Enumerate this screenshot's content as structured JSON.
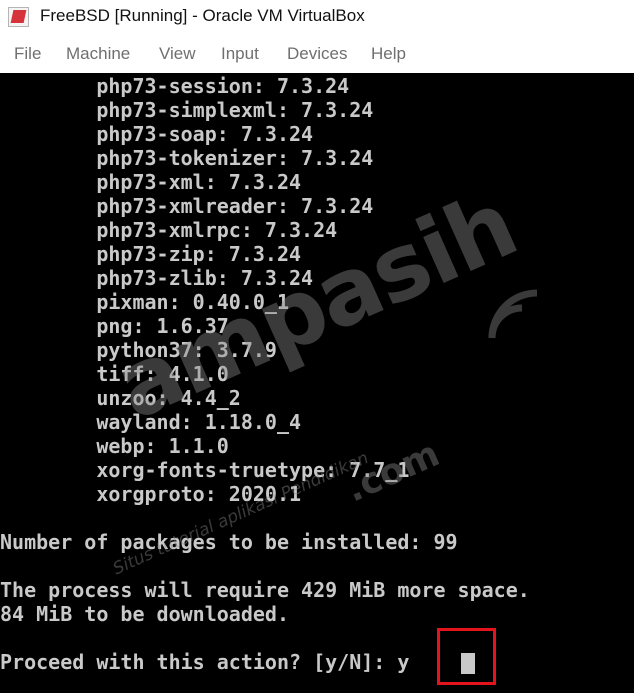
{
  "window": {
    "title": "FreeBSD [Running] - Oracle VM VirtualBox",
    "icon": "virtualbox-logo-icon"
  },
  "menu": [
    "File",
    "Machine",
    "View",
    "Input",
    "Devices",
    "Help"
  ],
  "terminal": {
    "lines": [
      "        php73-session: 7.3.24",
      "        php73-simplexml: 7.3.24",
      "        php73-soap: 7.3.24",
      "        php73-tokenizer: 7.3.24",
      "        php73-xml: 7.3.24",
      "        php73-xmlreader: 7.3.24",
      "        php73-xmlrpc: 7.3.24",
      "        php73-zip: 7.3.24",
      "        php73-zlib: 7.3.24",
      "        pixman: 0.40.0_1",
      "        png: 1.6.37",
      "        python37: 3.7.9",
      "        tiff: 4.1.0",
      "        unzoo: 4.4_2",
      "        wayland: 1.18.0_4",
      "        webp: 1.1.0",
      "        xorg-fonts-truetype: 7.7_1",
      "        xorgproto: 2020.1",
      "",
      "Number of packages to be installed: 99",
      "",
      "The process will require 429 MiB more space.",
      "84 MiB to be downloaded.",
      "",
      "Proceed with this action? [y/N]: y"
    ],
    "text_color": "#c9c9c9",
    "background": "#000000"
  },
  "watermark": {
    "brand": "ampasih",
    "domain": ".com",
    "tagline": "Situs tutorial aplikasi Pendidikan"
  },
  "highlight_color": "#e3141b"
}
